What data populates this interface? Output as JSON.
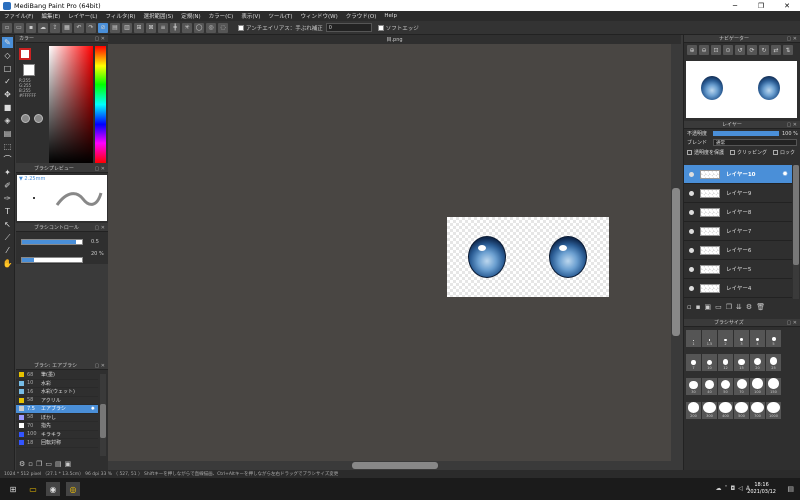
{
  "window": {
    "title": "MediBang Paint Pro (64bit)"
  },
  "menu": [
    "ファイル(F)",
    "編集(E)",
    "レイヤー(L)",
    "フィルタ(R)",
    "選択範囲(S)",
    "定規(N)",
    "カラー(C)",
    "表示(V)",
    "ツール(T)",
    "ウィンドウ(W)",
    "クラウド(O)",
    "Help"
  ],
  "toolbar": {
    "antialias_label": "アンチエイリアス：手ぶれ補正",
    "stabilizer_value": "0",
    "soft_edge_label": "ソフトエッジ"
  },
  "color_panel": {
    "title": "カラー",
    "rgb": [
      "R:255",
      "G:255",
      "B:255"
    ],
    "hex": "#FFFFFF",
    "fg": "#ffffff",
    "bg": "#ffffff"
  },
  "brush_preview": {
    "title": "ブラシプレビュー",
    "size_label": "▼ 2.25mm"
  },
  "brush_control": {
    "title": "ブラシコントロール",
    "size_value": "0.5",
    "opacity_value": "20 %",
    "size_fill": 0.9,
    "opacity_fill": 0.2
  },
  "brush_list": {
    "title": "ブラシ: エアブラシ",
    "items": [
      {
        "size": "68",
        "name": "筆(墨)",
        "color": "#e6c200"
      },
      {
        "size": "10",
        "name": "水彩",
        "color": "#77bde6"
      },
      {
        "size": "16",
        "name": "水彩(ウェット)",
        "color": "#77bde6"
      },
      {
        "size": "58",
        "name": "アクリル",
        "color": "#e6c200"
      },
      {
        "size": "7.5",
        "name": "エアブラシ",
        "color": "#cccccc",
        "selected": true
      },
      {
        "size": "58",
        "name": "ぼかし",
        "color": "#9999ff"
      },
      {
        "size": "70",
        "name": "指先",
        "color": "#ffffff"
      },
      {
        "size": "100",
        "name": "キラキラ",
        "color": "#3355ff"
      },
      {
        "size": "18",
        "name": "回転対称",
        "color": "#3355ff"
      }
    ]
  },
  "canvas": {
    "tab": "目.png"
  },
  "navigator": {
    "title": "ナビゲーター"
  },
  "layer_panel": {
    "title": "レイヤー",
    "opacity_label": "不透明度",
    "opacity_value": "100 %",
    "blend_label": "ブレンド",
    "blend_value": "通常",
    "protect_label": "透明度を保護",
    "clip_label": "クリッピング",
    "lock_label": "ロック",
    "layers": [
      {
        "name": "レイヤー10",
        "selected": true
      },
      {
        "name": "レイヤー9"
      },
      {
        "name": "レイヤー8"
      },
      {
        "name": "レイヤー7"
      },
      {
        "name": "レイヤー6"
      },
      {
        "name": "レイヤー5"
      },
      {
        "name": "レイヤー4"
      }
    ]
  },
  "brush_size": {
    "title": "ブラシサイズ",
    "sizes": [
      "1",
      "1.5",
      "2",
      "3",
      "4",
      "5",
      "7",
      "10",
      "12",
      "15",
      "20",
      "25",
      "30",
      "40",
      "50",
      "70",
      "100",
      "150",
      "200",
      "300",
      "400",
      "500",
      "700",
      "1000"
    ]
  },
  "status": {
    "text": "1024 * 512 pixel （27.1 * 13.5cm） 96 dpi  33 %  （ 527, 51 ）  Shiftキーを押しながらで直線描画、Ctrl+Altキーを押しながら左右ドラッグでブラシサイズ変更"
  },
  "taskbar": {
    "time": "18:16",
    "date": "2021/03/12",
    "lang": "A"
  }
}
